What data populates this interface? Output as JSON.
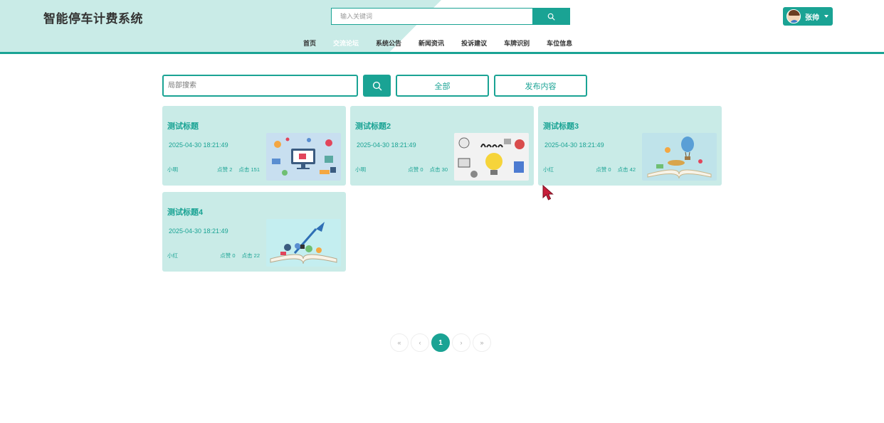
{
  "header": {
    "logo": "智能停车计费系统",
    "search_placeholder": "输入关键词",
    "user_name": "张帅"
  },
  "nav": {
    "items": [
      "首页",
      "交流论坛",
      "系统公告",
      "新闻资讯",
      "投诉建议",
      "车牌识别",
      "车位信息"
    ],
    "active": "交流论坛"
  },
  "filter": {
    "search_placeholder": "局部搜索",
    "all_label": "全部",
    "publish_label": "发布内容"
  },
  "posts": [
    {
      "title": "测试标题",
      "time": "2025-04-30 18:21:49",
      "author": "小明",
      "likes": "点赞 2",
      "clicks": "点击 151",
      "image": "computer-icons-illustration"
    },
    {
      "title": "测试标题2",
      "time": "2025-04-30 18:21:49",
      "author": "小明",
      "likes": "点赞 0",
      "clicks": "点击 30",
      "image": "learn-lightbulb-illustration"
    },
    {
      "title": "测试标题3",
      "time": "2025-04-30 18:21:49",
      "author": "小红",
      "likes": "点赞 0",
      "clicks": "点击 42",
      "image": "open-book-balloon-illustration"
    },
    {
      "title": "测试标题4",
      "time": "2025-04-30 18:21:49",
      "author": "小红",
      "likes": "点赞 0",
      "clicks": "点击 22",
      "image": "open-book-rocket-illustration"
    }
  ],
  "pagination": {
    "first": "«",
    "prev": "‹",
    "current": "1",
    "next": "›",
    "last": "»"
  },
  "colors": {
    "accent": "#1aa394",
    "card_bg": "#c9ebe7",
    "header_bg": "#c9ebe7"
  }
}
